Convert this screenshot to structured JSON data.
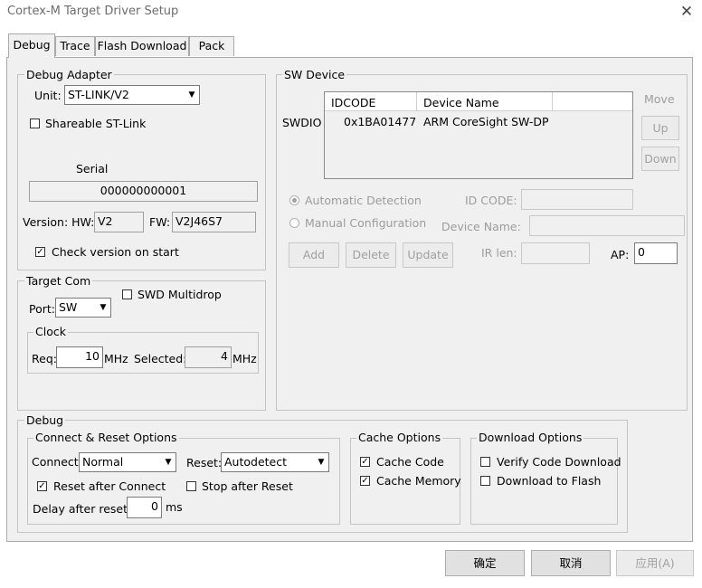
{
  "window": {
    "title": "Cortex-M Target Driver Setup"
  },
  "tabs": [
    "Debug",
    "Trace",
    "Flash Download",
    "Pack"
  ],
  "debug_adapter": {
    "label": "Debug Adapter",
    "unit_label": "Unit:",
    "unit_value": "ST-LINK/V2",
    "shareable_label": "Shareable ST-Link",
    "serial_label": "Serial",
    "serial_value": "000000000001",
    "version_label": "Version: HW:",
    "hw_value": "V2",
    "fw_label": "FW:",
    "fw_value": "V2J46S7",
    "check_version_label": "Check version on start"
  },
  "sw_device": {
    "label": "SW Device",
    "move_label": "Move",
    "up_label": "Up",
    "down_label": "Down",
    "row_label": "SWDIO",
    "columns": [
      "IDCODE",
      "Device Name"
    ],
    "rows": [
      {
        "idcode": "0x1BA01477",
        "name": "ARM CoreSight SW-DP"
      }
    ],
    "auto_detect_label": "Automatic Detection",
    "manual_config_label": "Manual Configuration",
    "id_code_label": "ID CODE:",
    "device_name_label": "Device Name:",
    "add_label": "Add",
    "delete_label": "Delete",
    "update_label": "Update",
    "ir_len_label": "IR len:",
    "ap_label": "AP:",
    "ap_value": "0"
  },
  "target_com": {
    "label": "Target Com",
    "port_label": "Port:",
    "port_value": "SW",
    "swd_multidrop_label": "SWD Multidrop",
    "clock_label": "Clock",
    "req_label": "Req:",
    "req_value": "10",
    "mhz_label": "MHz",
    "selected_label": "Selected:",
    "selected_value": "4",
    "mhz2_label": "MHz"
  },
  "debug": {
    "label": "Debug",
    "connect_reset_label": "Connect & Reset Options",
    "connect_label": "Connect:",
    "connect_value": "Normal",
    "reset_label": "Reset:",
    "reset_value": "Autodetect",
    "reset_after_connect_label": "Reset after Connect",
    "stop_after_reset_label": "Stop after Reset",
    "delay_label": "Delay after reset:",
    "delay_value": "0",
    "ms_label": "ms",
    "cache_options_label": "Cache Options",
    "cache_code_label": "Cache Code",
    "cache_memory_label": "Cache Memory",
    "download_options_label": "Download Options",
    "verify_code_label": "Verify Code Download",
    "download_flash_label": "Download to Flash"
  },
  "footer": {
    "ok_label": "确定",
    "cancel_label": "取消",
    "apply_label": "应用(A)"
  },
  "checks": {
    "check_mark": "✓",
    "combo_arrow": "▼"
  }
}
